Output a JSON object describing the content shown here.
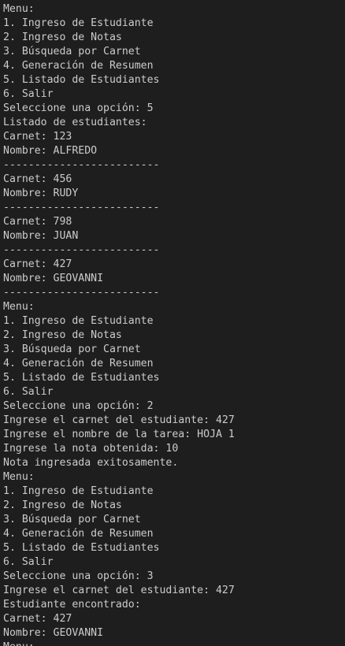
{
  "terminal": {
    "lines": [
      "Menu:",
      "1. Ingreso de Estudiante",
      "2. Ingreso de Notas",
      "3. Búsqueda por Carnet",
      "4. Generación de Resumen",
      "5. Listado de Estudiantes",
      "6. Salir",
      "Seleccione una opción: 5",
      "Listado de estudiantes:",
      "Carnet: 123",
      "Nombre: ALFREDO",
      "-------------------------",
      "Carnet: 456",
      "Nombre: RUDY",
      "-------------------------",
      "Carnet: 798",
      "Nombre: JUAN",
      "-------------------------",
      "Carnet: 427",
      "Nombre: GEOVANNI",
      "-------------------------",
      "Menu:",
      "1. Ingreso de Estudiante",
      "2. Ingreso de Notas",
      "3. Búsqueda por Carnet",
      "4. Generación de Resumen",
      "5. Listado de Estudiantes",
      "6. Salir",
      "Seleccione una opción: 2",
      "Ingrese el carnet del estudiante: 427",
      "Ingrese el nombre de la tarea: HOJA 1",
      "Ingrese la nota obtenida: 10",
      "Nota ingresada exitosamente.",
      "Menu:",
      "1. Ingreso de Estudiante",
      "2. Ingreso de Notas",
      "3. Búsqueda por Carnet",
      "4. Generación de Resumen",
      "5. Listado de Estudiantes",
      "6. Salir",
      "Seleccione una opción: 3",
      "Ingrese el carnet del estudiante: 427",
      "Estudiante encontrado:",
      "Carnet: 427",
      "Nombre: GEOVANNI",
      "Menu:"
    ]
  }
}
